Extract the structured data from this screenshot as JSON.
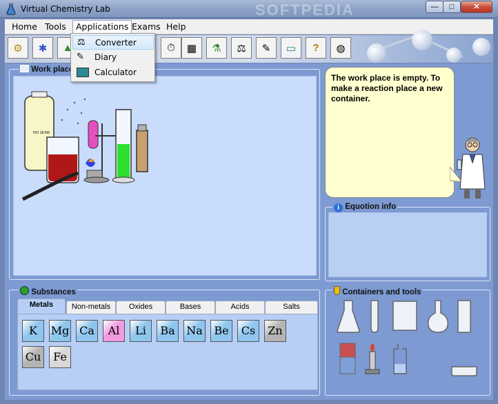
{
  "window": {
    "title": "Virtual Chemistry Lab",
    "watermark": "SOFTPEDIA",
    "controls": {
      "minimize": "—",
      "maximize": "□",
      "close": "✕"
    }
  },
  "menu": {
    "items": [
      "Home",
      "Tools",
      "Applications",
      "Exams",
      "Help"
    ]
  },
  "applications_menu": {
    "items": [
      "Converter",
      "Diary",
      "Calculator"
    ]
  },
  "toolbar": {
    "icons": [
      "gear-icon",
      "molecule-icon",
      "flask-icon",
      "converter-icon",
      "diary-icon",
      "calculator-icon",
      "stopwatch-icon",
      "table-icon",
      "beakers-icon",
      "scale-icon",
      "notes-icon",
      "display-icon",
      "help-icon",
      "dish-icon"
    ]
  },
  "work_place": {
    "title": "Work place",
    "message": "The work place is empty. To make a reaction place a new container."
  },
  "equation_info": {
    "title": "Equotion info"
  },
  "substances": {
    "title": "Substances",
    "tabs": [
      "Metals",
      "Non-metals",
      "Oxides",
      "Bases",
      "Acids",
      "Salts"
    ],
    "active_tab": "Metals",
    "elements": [
      {
        "symbol": "K",
        "color": "#8fc6ee"
      },
      {
        "symbol": "Mg",
        "color": "#8fc6ee"
      },
      {
        "symbol": "Ca",
        "color": "#8fc6ee"
      },
      {
        "symbol": "Al",
        "color": "#f09adf"
      },
      {
        "symbol": "Li",
        "color": "#8fc6ee"
      },
      {
        "symbol": "Ba",
        "color": "#8fc6ee"
      },
      {
        "symbol": "Na",
        "color": "#8fc6ee"
      },
      {
        "symbol": "Be",
        "color": "#8fc6ee"
      },
      {
        "symbol": "Cs",
        "color": "#8fc6ee"
      },
      {
        "symbol": "Zn",
        "color": "#b4b4b4"
      },
      {
        "symbol": "Cu",
        "color": "#b4b4b4"
      },
      {
        "symbol": "Fe",
        "color": "#d8d8d8"
      }
    ]
  },
  "containers": {
    "title": "Containers and tools",
    "items": [
      "erlenmeyer-flask",
      "test-tube",
      "beaker",
      "round-flask",
      "cylinder",
      "cooler-block",
      "burner",
      "gas-flask",
      "dish"
    ]
  },
  "illustration": {
    "bottle_label": "HCl 18.5M"
  }
}
